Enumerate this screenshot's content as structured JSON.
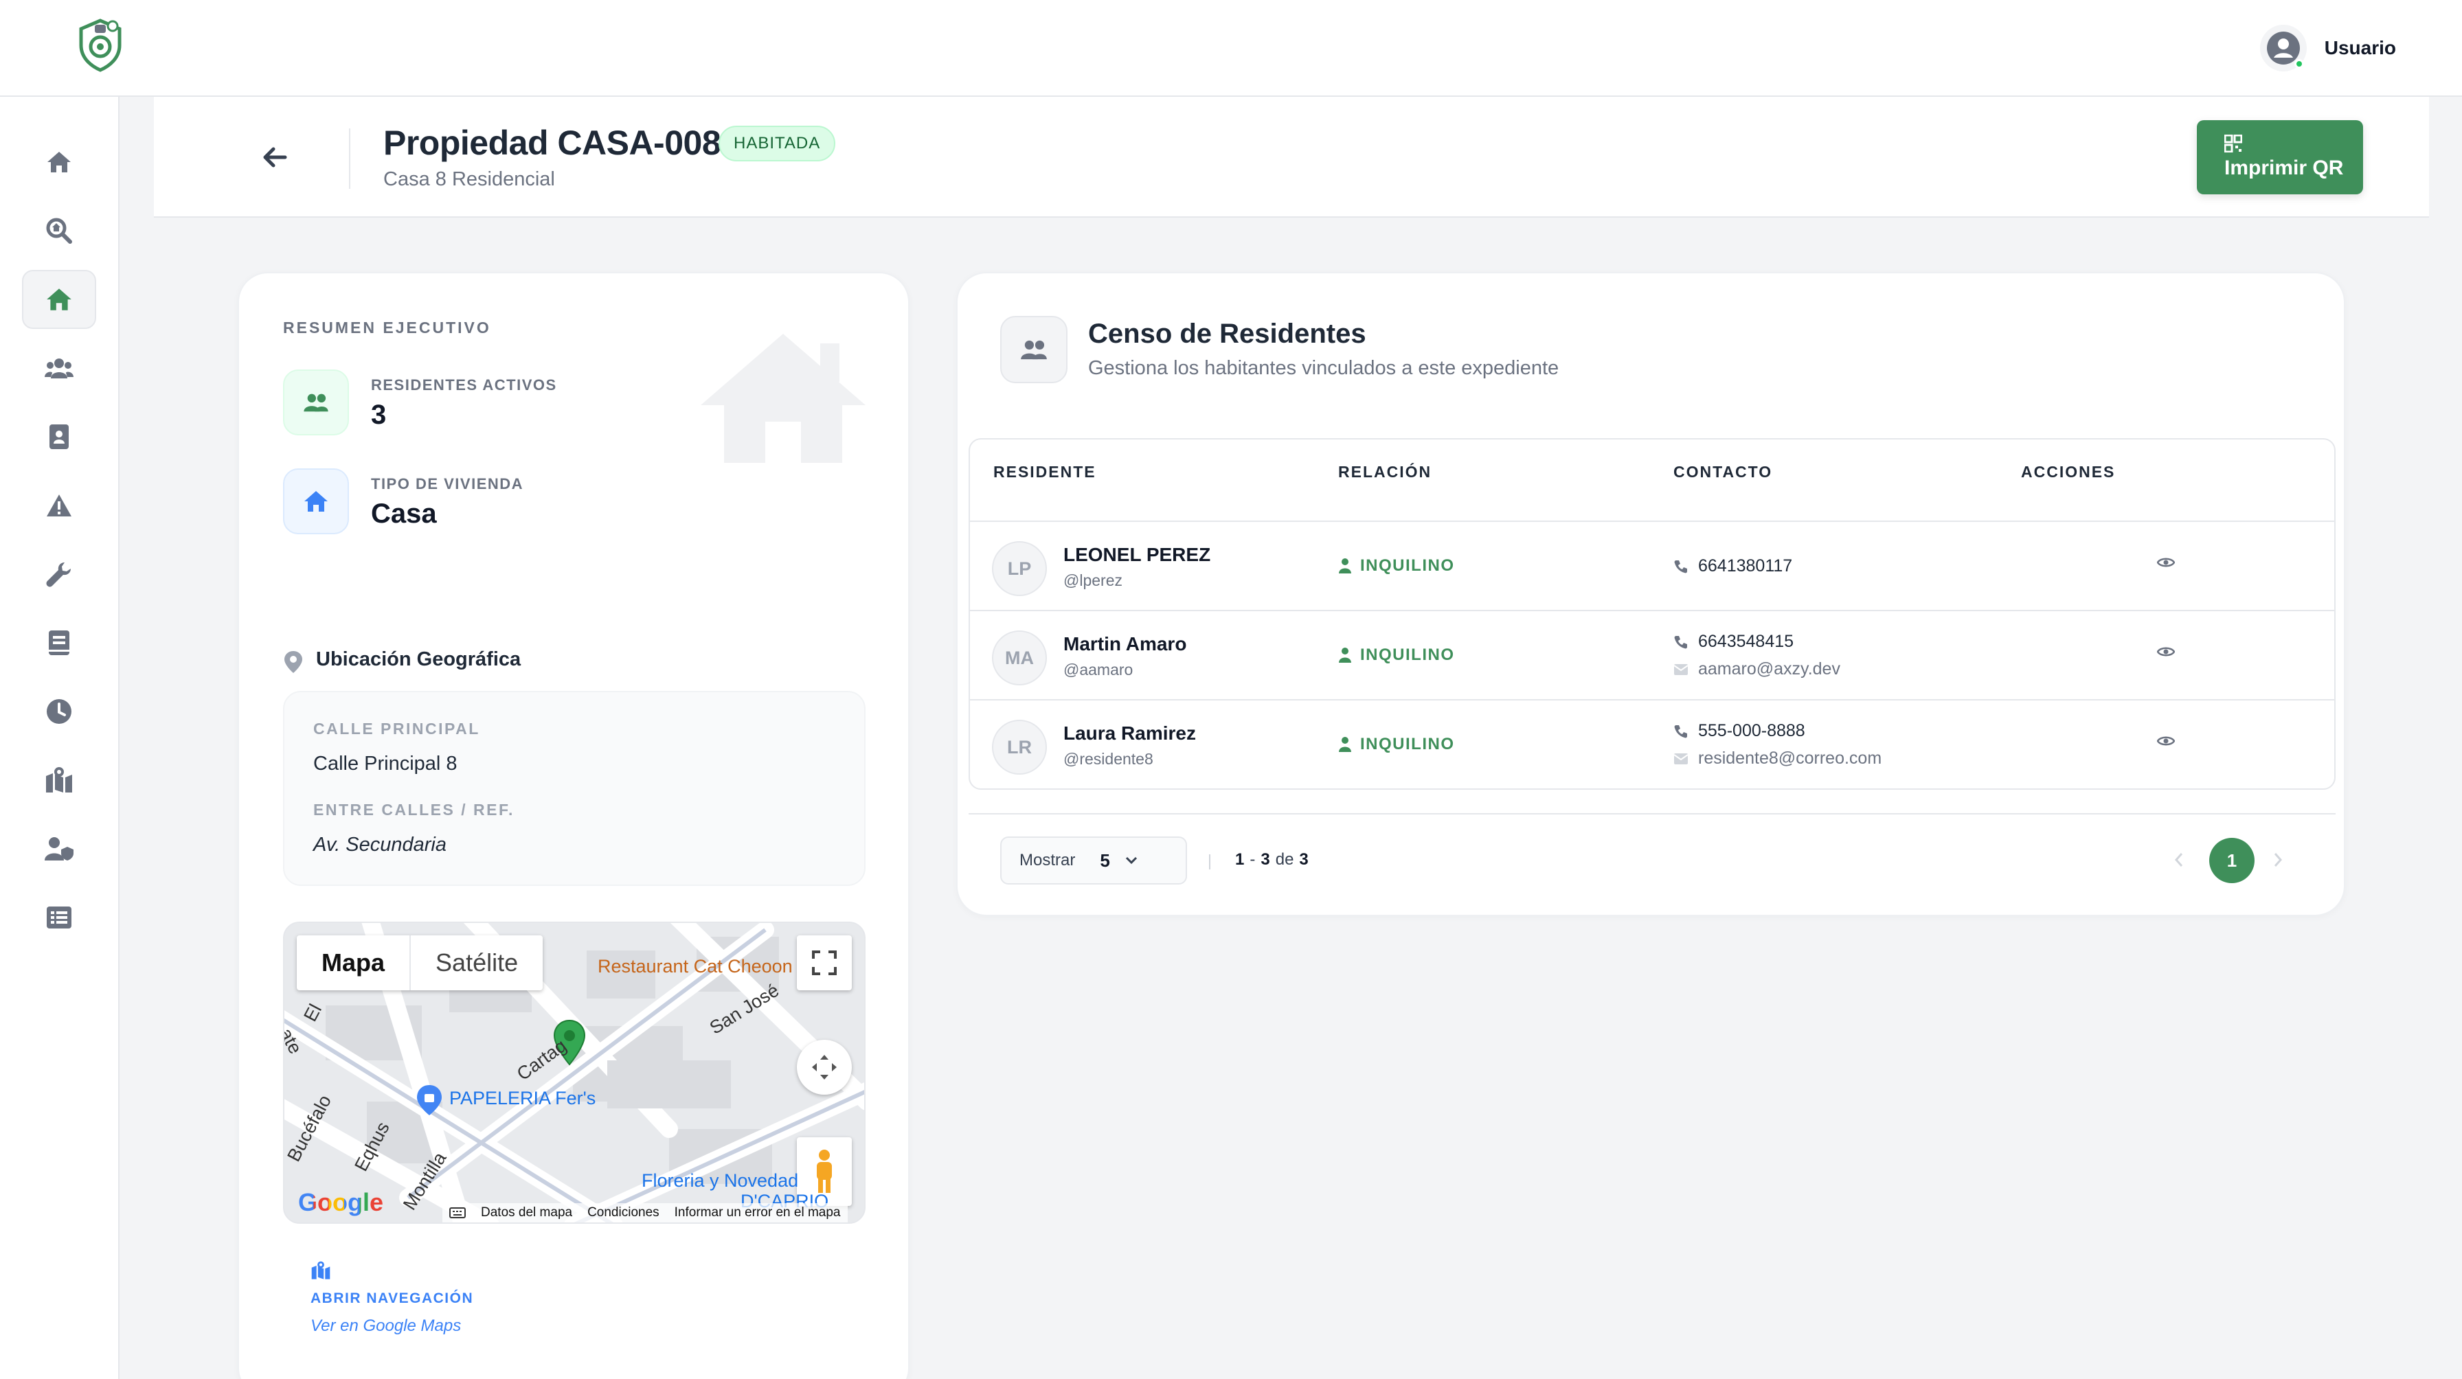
{
  "user": {
    "name": "Usuario"
  },
  "header": {
    "title": "Propiedad CASA-008",
    "status": "HABITADA",
    "subtitle": "Casa 8 Residencial",
    "qr_button": "Imprimir QR"
  },
  "summary": {
    "section_label": "RESUMEN EJECUTIVO",
    "active_residents_label": "RESIDENTES ACTIVOS",
    "active_residents_value": "3",
    "housing_type_label": "TIPO DE VIVIENDA",
    "housing_type_value": "Casa"
  },
  "location": {
    "title": "Ubicación Geográfica",
    "street_label": "CALLE PRINCIPAL",
    "street_value": "Calle Principal 8",
    "between_label": "ENTRE CALLES / REF.",
    "between_value": "Av. Secundaria",
    "open_nav_label": "ABRIR NAVEGACIÓN",
    "open_nav_link": "Ver en Google Maps"
  },
  "map": {
    "tab_map": "Mapa",
    "tab_satellite": "Satélite",
    "labels": {
      "restaurant": "Restaurant Cat Cheoon",
      "papeleria": "PAPELERIA Fer's",
      "floreria": "Floreria y Novedad",
      "dcaprio": "D'CAPRIO",
      "san_jose": "San José",
      "cartag": "Cartag",
      "bucefalo": "Bucéfalo",
      "eqhus": "Eqhus",
      "montilla": "Montilla",
      "el": "El",
      "ate": "ate"
    },
    "google": "Google",
    "footer": {
      "data": "Datos del mapa",
      "terms": "Condiciones",
      "report": "Informar un error en el mapa"
    }
  },
  "census": {
    "title": "Censo de Residentes",
    "subtitle": "Gestiona los habitantes vinculados a este expediente",
    "columns": [
      "RESIDENTE",
      "RELACIÓN",
      "CONTACTO",
      "ACCIONES"
    ],
    "rows": [
      {
        "initials": "LP",
        "name": "LEONEL PEREZ",
        "username": "@lperez",
        "relation": "INQUILINO",
        "phone": "6641380117",
        "email": ""
      },
      {
        "initials": "MA",
        "name": "Martin Amaro",
        "username": "@aamaro",
        "relation": "INQUILINO",
        "phone": "6643548415",
        "email": "aamaro@axzy.dev"
      },
      {
        "initials": "LR",
        "name": "Laura Ramirez",
        "username": "@residente8",
        "relation": "INQUILINO",
        "phone": "555-000-8888",
        "email": "residente8@correo.com"
      }
    ],
    "pager": {
      "show_label": "Mostrar",
      "page_size": "5",
      "range_from": "1",
      "range_sep": "-",
      "range_to": "3",
      "range_of": "de",
      "total": "3",
      "current_page": "1"
    }
  },
  "colors": {
    "brand_green": "#3f8f5a",
    "accent_blue": "#3b82f6"
  }
}
